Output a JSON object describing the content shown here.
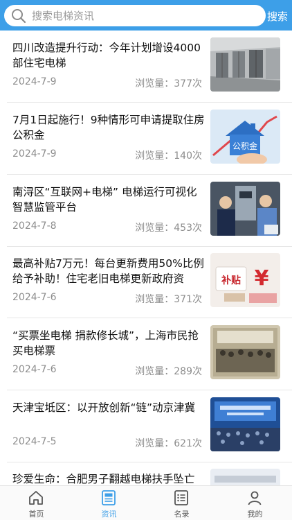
{
  "search": {
    "placeholder": "搜索电梯资讯",
    "button_label": "搜索"
  },
  "news": [
    {
      "title": "四川改造提升行动：今年计划增设4000部住宅电梯",
      "date": "2024-7-9",
      "views": "浏览量：377次",
      "thumb": "elevator-lobby-photo"
    },
    {
      "title": "7月1日起施行！9种情形可申请提取住房公积金",
      "date": "2024-7-9",
      "views": "浏览量：140次",
      "thumb": "housing-fund-house-photo",
      "thumb_text": "公积金"
    },
    {
      "title": "南浔区“互联网+电梯” 电梯运行可视化智慧监管平台",
      "date": "2024-7-8",
      "views": "浏览量：453次",
      "thumb": "elevator-inspection-photo"
    },
    {
      "title": "最高补贴7万元！每台更新费用50%比例给予补助！住宅老旧电梯更新政府资",
      "date": "2024-7-6",
      "views": "浏览量：371次",
      "thumb": "subsidy-photo",
      "thumb_text": "补贴"
    },
    {
      "title": "“买票坐电梯 捐款修长城”，上海市民抢买电梯票",
      "date": "2024-7-6",
      "views": "浏览量：289次",
      "thumb": "historic-crowd-photo"
    },
    {
      "title": "天津宝坻区：以开放创新“链”动京津冀",
      "date": "2024-7-5",
      "views": "浏览量：621次",
      "thumb": "conference-photo"
    },
    {
      "title": "珍爱生命：合肥男子翻越电梯扶手坠亡",
      "date": "",
      "views": "",
      "thumb": "escalator-photo"
    }
  ],
  "tabs": [
    {
      "label": "首页",
      "icon": "home-icon",
      "active": false
    },
    {
      "label": "资讯",
      "icon": "news-icon",
      "active": true
    },
    {
      "label": "名录",
      "icon": "directory-icon",
      "active": false
    },
    {
      "label": "我的",
      "icon": "profile-icon",
      "active": false
    }
  ],
  "colors": {
    "accent": "#3d9fe8",
    "meta_text": "#8c8c8c",
    "tab_inactive": "#555555"
  }
}
